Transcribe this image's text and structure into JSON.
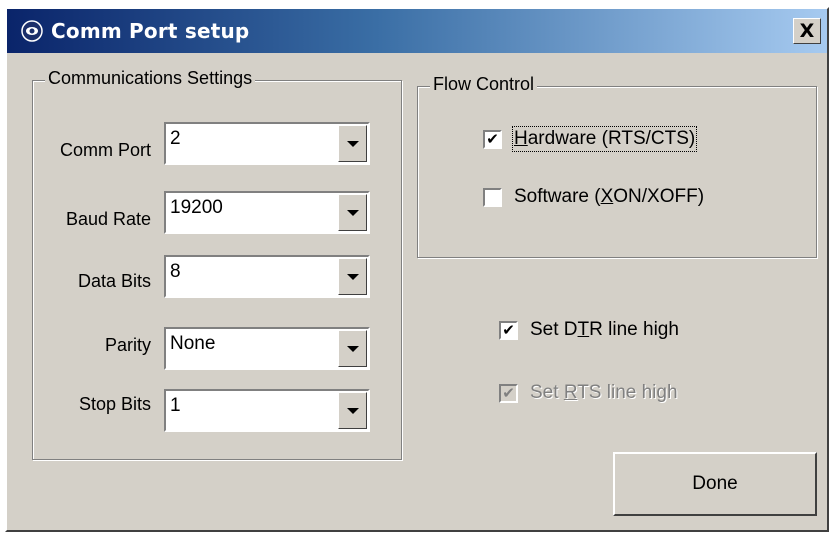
{
  "window": {
    "title": "Comm Port setup",
    "close_label": "X",
    "titlebar_colors": [
      "#0a246a",
      "#a6caf0"
    ],
    "face_color": "#d4d0c8"
  },
  "comm_settings": {
    "legend": "Communications Settings",
    "comm_port": {
      "label": "Comm Port",
      "value": "2"
    },
    "baud_rate": {
      "label": "Baud Rate",
      "value": "19200"
    },
    "data_bits": {
      "label": "Data Bits",
      "value": "8"
    },
    "parity": {
      "label": "Parity",
      "value": "None"
    },
    "stop_bits": {
      "label": "Stop Bits",
      "value": "1"
    }
  },
  "flow_control": {
    "legend": "Flow Control",
    "hardware": {
      "pre": "",
      "key": "H",
      "post": "ardware (RTS/CTS)",
      "checked": true
    },
    "software": {
      "pre": "Software (",
      "key": "X",
      "post": "ON/XOFF)",
      "checked": false
    }
  },
  "lines": {
    "dtr": {
      "pre": "Set D",
      "key": "T",
      "post": "R line high",
      "checked": true,
      "enabled": true
    },
    "rts": {
      "pre": "Set ",
      "key": "R",
      "post": "TS line high",
      "checked": true,
      "enabled": false
    }
  },
  "buttons": {
    "done": "Done"
  },
  "icons": {
    "window": "app-icon",
    "close": "close-icon",
    "dropdown": "chevron-down-icon",
    "check": "checkmark-icon"
  }
}
